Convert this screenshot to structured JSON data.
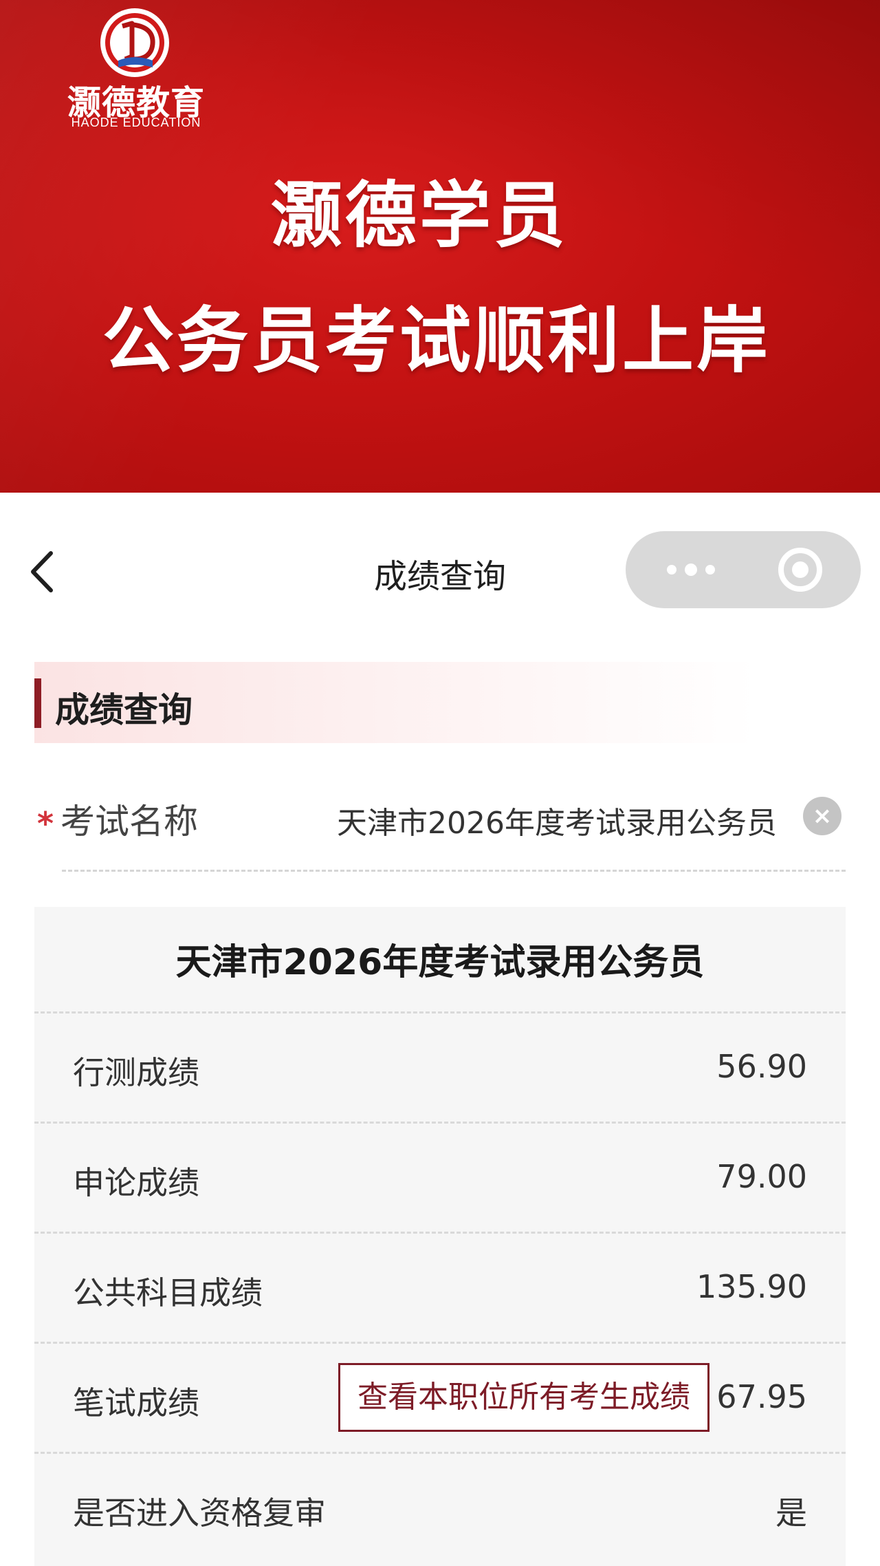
{
  "banner": {
    "logo_name": "灏德教育",
    "logo_sub": "HAODE EDUCATION",
    "headline_line1": "灏德学员",
    "headline_line2": "公务员考试顺利上岸",
    "colors": {
      "background": "#c31212",
      "text": "#ffffff"
    }
  },
  "navbar": {
    "title": "成绩查询",
    "back_icon": "chevron-left-icon",
    "more_icon": "more-dots-icon",
    "close_icon": "target-circle-icon"
  },
  "section": {
    "title": "成绩查询",
    "accent_color": "#8e1d25"
  },
  "exam_field": {
    "required_mark": "*",
    "label": "考试名称",
    "value": "天津市2026年度考试录用公务员",
    "clear_icon": "clear-x-icon",
    "clear_glyph": "×"
  },
  "score_card": {
    "title": "天津市2026年度考试录用公务员",
    "rows": [
      {
        "label": "行测成绩",
        "value": "56.90"
      },
      {
        "label": "申论成绩",
        "value": "79.00"
      },
      {
        "label": "公共科目成绩",
        "value": "135.90"
      },
      {
        "label": "笔试成绩",
        "value": "67.95",
        "button": "查看本职位所有考生成绩"
      },
      {
        "label": "是否进入资格复审",
        "value": "是"
      }
    ]
  }
}
